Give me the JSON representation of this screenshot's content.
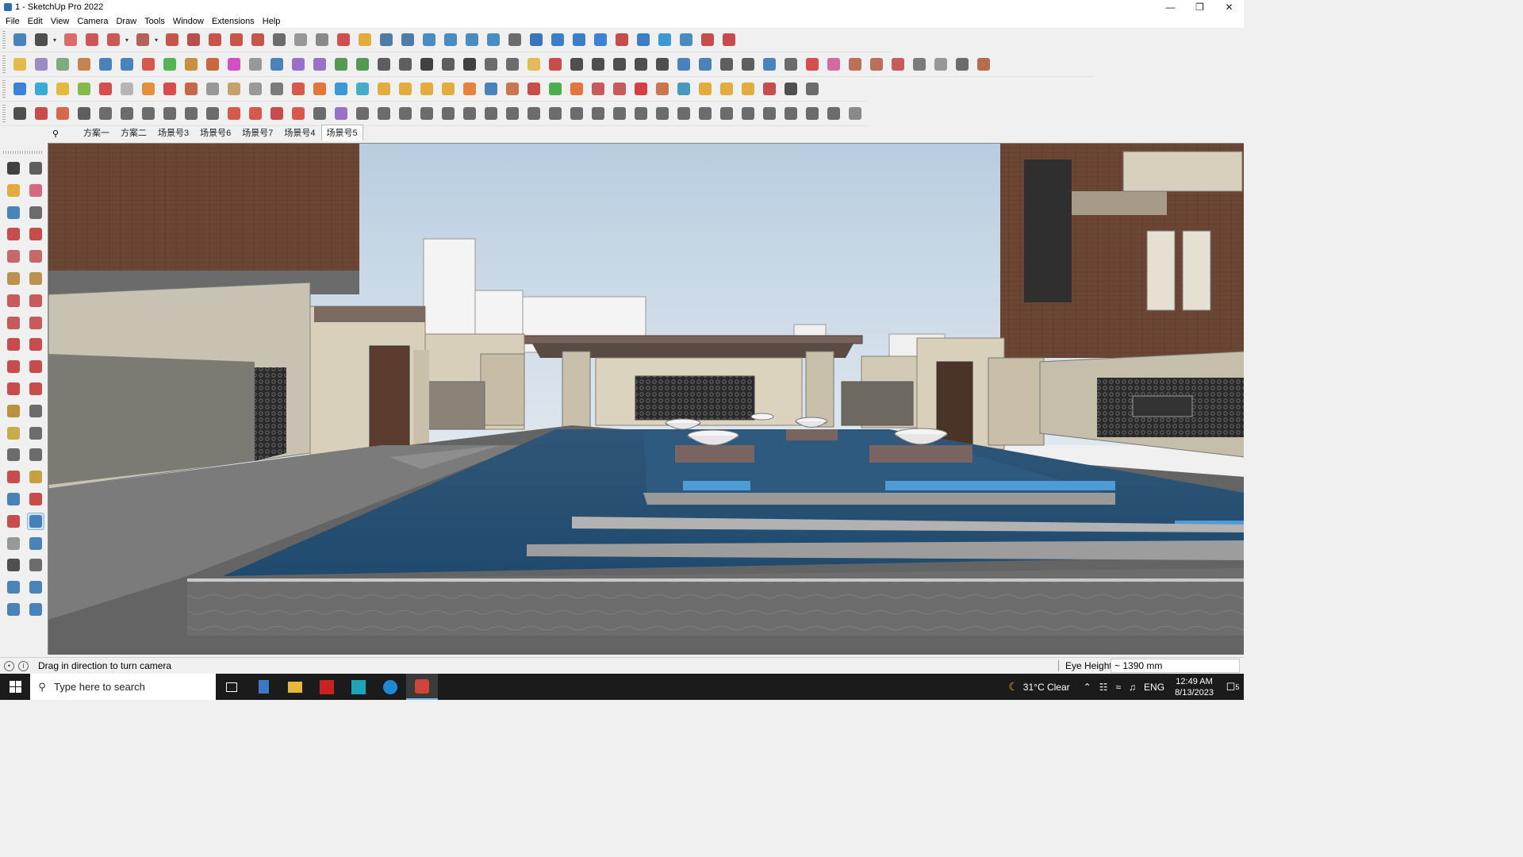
{
  "window": {
    "title": "1 - SketchUp Pro 2022",
    "icon": "sketchup-icon",
    "controls": [
      "minimize-icon",
      "restore-icon",
      "close-icon"
    ]
  },
  "menubar": {
    "items": [
      "File",
      "Edit",
      "View",
      "Camera",
      "Draw",
      "Tools",
      "Window",
      "Extensions",
      "Help"
    ]
  },
  "toolbars": {
    "row1_colors": [
      "#2d6fb0",
      "#333",
      "#d9534f",
      "#c43c3c",
      "#c43c3c",
      "#a9483b",
      "#c0392b",
      "#b03030",
      "#c0392b",
      "#c0392b",
      "#c0392b",
      "#555",
      "#888",
      "#777",
      "#cc3333",
      "#e0a020",
      "#336699",
      "#336699",
      "#2d7ab8",
      "#2d7ab8",
      "#2d7ab8",
      "#2d7ab8",
      "#555",
      "#1a5fb0",
      "#1a6bbf",
      "#1a6bbf",
      "#1f6fd0",
      "#c03030",
      "#1a6bbf",
      "#1a8ad0",
      "#2d7ab8",
      "#c03030",
      "#c03030"
    ],
    "row2_colors": [
      "#e0b030",
      "#8a7bb8",
      "#6aa06a",
      "#c07030",
      "#2d6fb0",
      "#2d6fb0",
      "#d04030",
      "#3aaa3a",
      "#c08020",
      "#c05020",
      "#d030c0",
      "#888",
      "#2d6fb0",
      "#8a5cc0",
      "#8a5cc0",
      "#3a8a3a",
      "#3a8a3a",
      "#444",
      "#444",
      "#222",
      "#444",
      "#222",
      "#555",
      "#555",
      "#e0b040",
      "#c03030",
      "#333",
      "#333",
      "#333",
      "#333",
      "#333",
      "#2d6fb0",
      "#2d6fb0",
      "#444",
      "#444",
      "#2d6fb0",
      "#555",
      "#d03030",
      "#d05090",
      "#b05a40",
      "#b05a40",
      "#c04040",
      "#666",
      "#888",
      "#555",
      "#aa5533"
    ],
    "row3_colors": [
      "#1a6fd0",
      "#1a9fd0",
      "#e0b020",
      "#70b030",
      "#d03030",
      "#aaa",
      "#e08020",
      "#d03030",
      "#c05030",
      "#888",
      "#c09050",
      "#888",
      "#666",
      "#d04030",
      "#e06020",
      "#1a8ad0",
      "#2aa0c0",
      "#e0a020",
      "#e0a020",
      "#e0a020",
      "#e0a020",
      "#e07020",
      "#2d6fb0",
      "#c06030",
      "#c03030",
      "#30a030",
      "#e06020",
      "#c04040",
      "#c04040",
      "#d02020",
      "#c06030",
      "#2d8ab0",
      "#e0a020",
      "#e0a020",
      "#e0a020",
      "#c03030",
      "#333",
      "#555"
    ],
    "row4_colors": [
      "#333",
      "#c03030",
      "#d05030",
      "#444",
      "#555",
      "#555",
      "#555",
      "#555",
      "#555",
      "#555",
      "#d04030",
      "#d04030",
      "#c03030",
      "#d04030",
      "#555",
      "#8a5cc0",
      "#555",
      "#555",
      "#555",
      "#555",
      "#555",
      "#555",
      "#555",
      "#555",
      "#555",
      "#555",
      "#555",
      "#555",
      "#555",
      "#555",
      "#555",
      "#555",
      "#555",
      "#555",
      "#555",
      "#555",
      "#555",
      "#555",
      "#555",
      "#777"
    ],
    "left_colors": [
      "#222",
      "#444",
      "#e0a020",
      "#d05070",
      "#2d6fb0",
      "#555",
      "#c03030",
      "#c03030",
      "#c05050",
      "#c05050",
      "#b08030",
      "#b08030",
      "#c04040",
      "#c04040",
      "#c04040",
      "#c04040",
      "#c03030",
      "#c03030",
      "#c03030",
      "#c03030",
      "#c03030",
      "#c03030",
      "#b08020",
      "#555",
      "#c0a030",
      "#555",
      "#555",
      "#555",
      "#c03030",
      "#c09020",
      "#2d6fb0",
      "#c03030",
      "#c03030",
      "#2d6fb0",
      "#888",
      "#2d6fb0",
      "#333",
      "#555",
      "#2d6fb0",
      "#2d6fb0",
      "#2d6fb0",
      "#2d6fb0"
    ]
  },
  "scenes": {
    "search_icon": "search-icon",
    "tabs": [
      "方案一",
      "方案二",
      "场景号3",
      "场景号6",
      "场景号7",
      "场景号4",
      "场景号5"
    ],
    "active_index": 6
  },
  "left_toolbar": {
    "selected_tool": "look-around-icon"
  },
  "status": {
    "message": "Drag in direction to turn camera",
    "vcb_label": "Eye Height",
    "vcb_value": "~ 1390 mm"
  },
  "taskbar": {
    "search_placeholder": "Type here to search",
    "apps": [
      "task-view-icon",
      "calculator-icon",
      "file-explorer-icon",
      "acrobat-icon",
      "3dsmax-icon",
      "edge-icon",
      "sketchup-icon"
    ],
    "weather": "31°C  Clear",
    "language": "ENG",
    "time": "12:49 AM",
    "date": "8/13/2023",
    "notifications": "5"
  }
}
